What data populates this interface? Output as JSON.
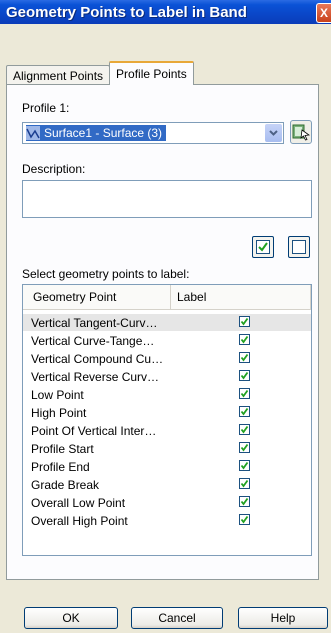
{
  "window": {
    "title": "Geometry Points to Label in Band",
    "close_glyph": "X"
  },
  "tabs": [
    {
      "label": "Alignment Points",
      "active": false
    },
    {
      "label": "Profile Points",
      "active": true
    }
  ],
  "profile": {
    "label": "Profile 1:",
    "selected_value": "Surface1 - Surface (3)",
    "selected_icon": "profile-surface-icon"
  },
  "description": {
    "label": "Description:",
    "value": ""
  },
  "grid": {
    "label": "Select geometry points to label:",
    "columns": [
      "Geometry Point",
      "Label"
    ],
    "rows": [
      {
        "name": "Vertical Tangent-Curv…",
        "checked": true
      },
      {
        "name": "Vertical Curve-Tange…",
        "checked": true
      },
      {
        "name": "Vertical Compound Cu…",
        "checked": true
      },
      {
        "name": "Vertical Reverse Curv…",
        "checked": true
      },
      {
        "name": "Low Point",
        "checked": true
      },
      {
        "name": "High Point",
        "checked": true
      },
      {
        "name": "Point Of Vertical Inter…",
        "checked": true
      },
      {
        "name": "Profile Start",
        "checked": true
      },
      {
        "name": "Profile End",
        "checked": true
      },
      {
        "name": "Grade Break",
        "checked": true
      },
      {
        "name": "Overall Low Point",
        "checked": true
      },
      {
        "name": "Overall High Point",
        "checked": true
      }
    ]
  },
  "buttons": {
    "ok": "OK",
    "cancel": "Cancel",
    "help": "Help"
  },
  "colors": {
    "check": "#21A121",
    "title_bar": "#0A52D6",
    "selection": "#316AC5"
  }
}
